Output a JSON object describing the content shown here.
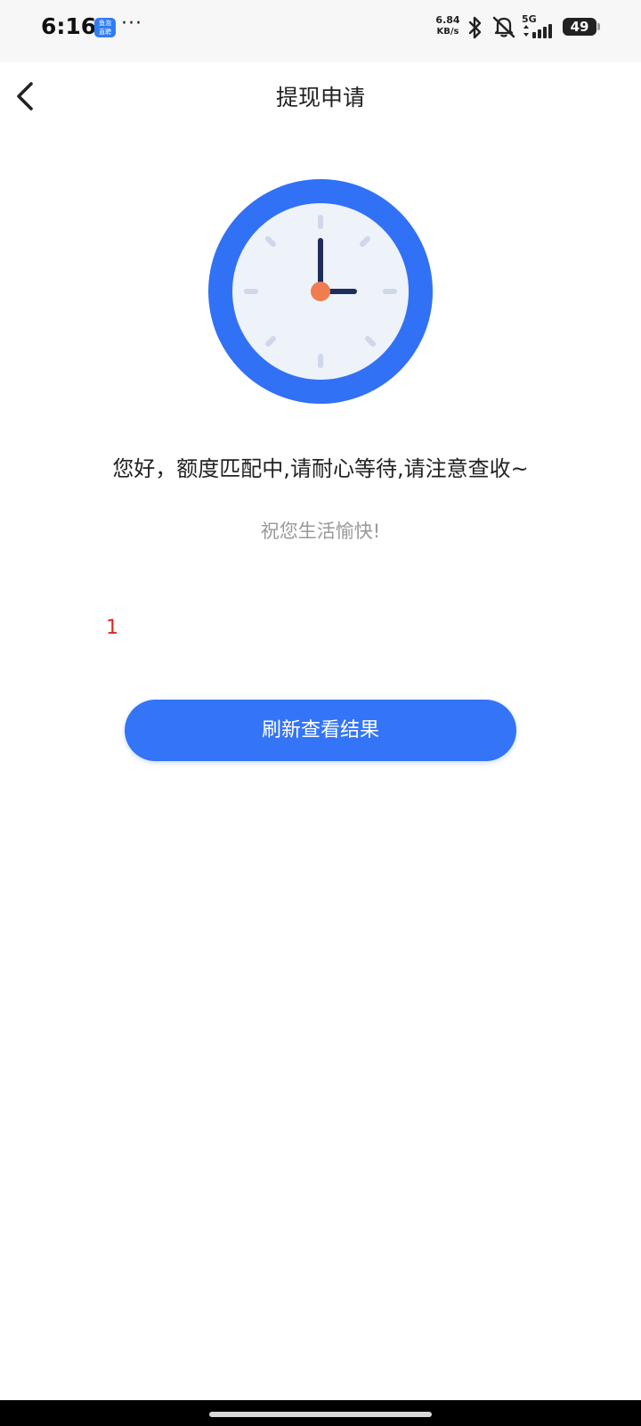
{
  "status_bar": {
    "time": "6:16",
    "app_badge_line1": "鱼泡",
    "app_badge_line2": "直聘",
    "more": "···",
    "net_speed_value": "6.84",
    "net_speed_unit": "KB/s",
    "signal_label": "5G",
    "battery": "49"
  },
  "header": {
    "title": "提现申请"
  },
  "main": {
    "message": "您好，额度匹配中,请耐心等待,请注意查收~",
    "sub_message": "祝您生活愉快!",
    "counter": "1",
    "refresh_button_label": "刷新查看结果"
  },
  "colors": {
    "accent": "#3474f6",
    "clock_ring": "#3171f5",
    "clock_face": "#eef2f9",
    "clock_hand": "#1f2d5c",
    "clock_center": "#f07c4f",
    "counter": "#d9281f"
  }
}
